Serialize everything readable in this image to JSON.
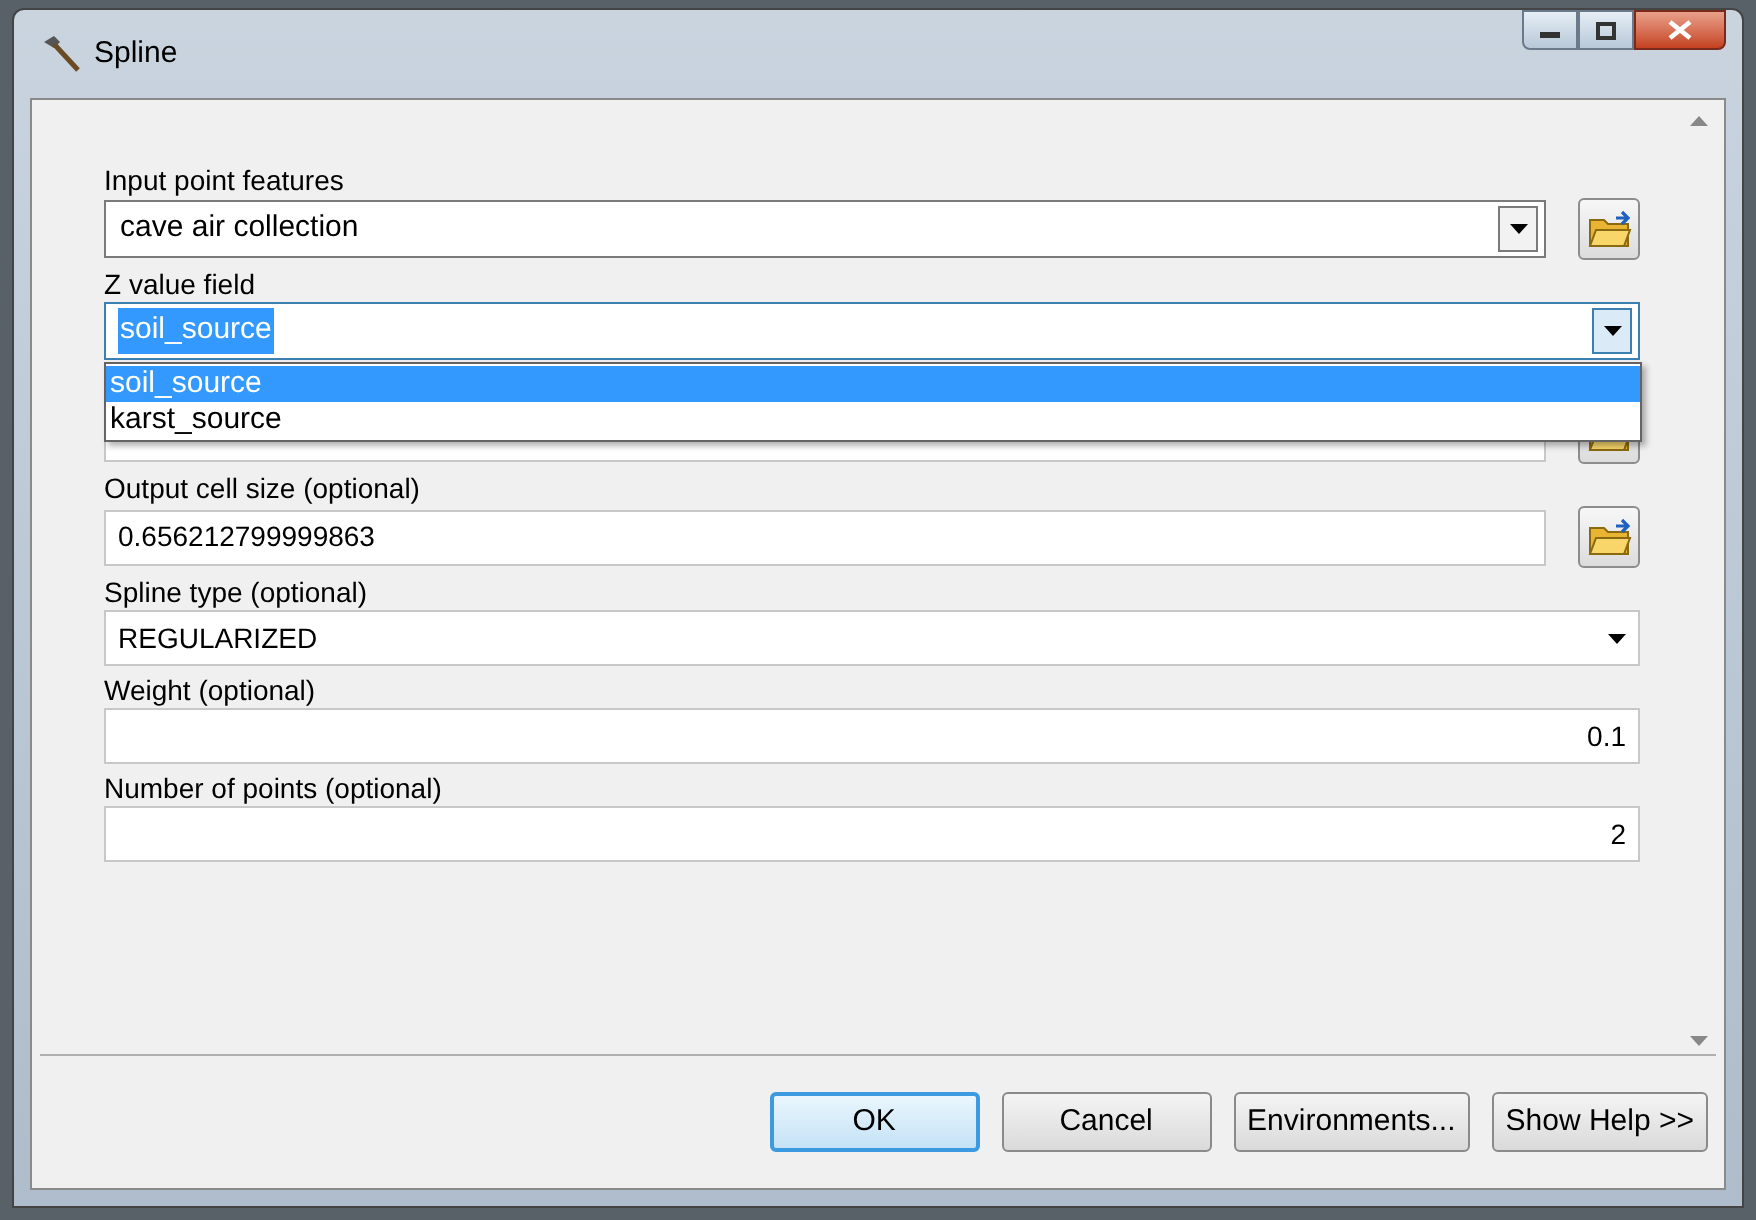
{
  "window": {
    "title": "Spline"
  },
  "fields": [
    {
      "kind": "combo",
      "label": "Input point features",
      "value": "cave air collection",
      "browse": true,
      "focused": false
    },
    {
      "kind": "combo",
      "label": "Z value field",
      "value": "soil_source",
      "browse": false,
      "focused": true,
      "options": [
        {
          "label": "soil_source",
          "selected": true
        },
        {
          "label": "karst_source",
          "selected": false
        }
      ]
    },
    {
      "kind": "hidden",
      "browse": true
    },
    {
      "kind": "text",
      "label": "Output cell size (optional)",
      "value": "0.656212799999863",
      "browse": true
    },
    {
      "kind": "select",
      "label": "Spline type (optional)",
      "value": "REGULARIZED",
      "browse": false
    },
    {
      "kind": "number",
      "label": "Weight (optional)",
      "value": "0.1",
      "browse": false
    },
    {
      "kind": "number",
      "label": "Number of points (optional)",
      "value": "2",
      "browse": false
    }
  ],
  "buttons": [
    {
      "label": "OK",
      "default": true
    },
    {
      "label": "Cancel",
      "default": false
    },
    {
      "label": "Environments...",
      "default": false
    },
    {
      "label": "Show Help >>",
      "default": false
    }
  ]
}
